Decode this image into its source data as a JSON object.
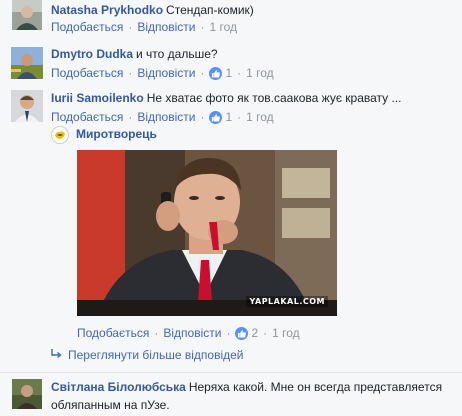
{
  "comments": [
    {
      "author": "Natasha Prykhodko",
      "text": "Стендап-комик)",
      "like": "Подобається",
      "reply": "Відповісти",
      "time": "1 год"
    },
    {
      "author": "Dmytro Dudka",
      "text": "и что дальше?",
      "like": "Подобається",
      "reply": "Відповісти",
      "reactions": "1",
      "time": "1 год"
    },
    {
      "author": "Iurii Samoilenko",
      "text": "Не хватає фото як тов.саакова жує кравату ...",
      "like": "Подобається",
      "reply": "Відповісти",
      "reactions": "1",
      "time": "1 год"
    },
    {
      "author": "Світлана Білолюбська",
      "text": "Неряха какой. Мне он всегда представляется",
      "text2": "обляпанным на пУзе."
    }
  ],
  "shared_post": {
    "page_name": "Миротворець",
    "watermark": "YAPLAKAL.COM",
    "like": "Подобається",
    "reply": "Відповісти",
    "reactions": "2",
    "time": "1 год"
  },
  "more_replies": "Переглянути більше відповідей",
  "colors": {
    "link": "#365899",
    "action": "#4267b2",
    "meta": "#90949c",
    "reaction_badge": "#5890ff",
    "background": "#f6f7f9"
  },
  "icons": [
    "like-reaction-icon",
    "reply-arrow-icon",
    "page-logo-icon"
  ]
}
